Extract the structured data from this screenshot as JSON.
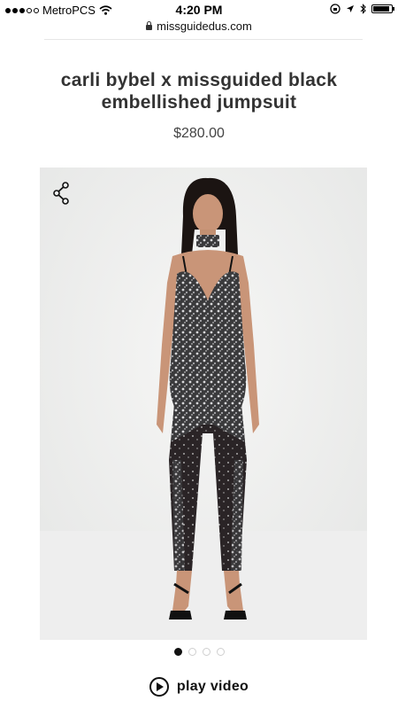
{
  "status_bar": {
    "carrier": "MetroPCS",
    "time": "4:20 PM",
    "signal_filled": 3,
    "signal_total": 5,
    "battery_level": 0.9
  },
  "browser": {
    "url": "missguidedus.com"
  },
  "product": {
    "title": "carli bybel x missguided black embellished jumpsuit",
    "price": "$280.00"
  },
  "gallery": {
    "image_count": 4,
    "active_index": 0
  },
  "video": {
    "label": "play video"
  },
  "icons": {
    "share": "share-icon",
    "play": "play-circle-icon",
    "lock": "lock-icon",
    "wifi": "wifi-icon",
    "bluetooth": "bluetooth-icon",
    "location": "location-arrow-icon",
    "rotation_lock": "rotation-lock-icon",
    "battery": "battery-icon"
  },
  "colors": {
    "image_background": "#f0f1f0",
    "text": "#333333",
    "active_dot": "#111111"
  }
}
